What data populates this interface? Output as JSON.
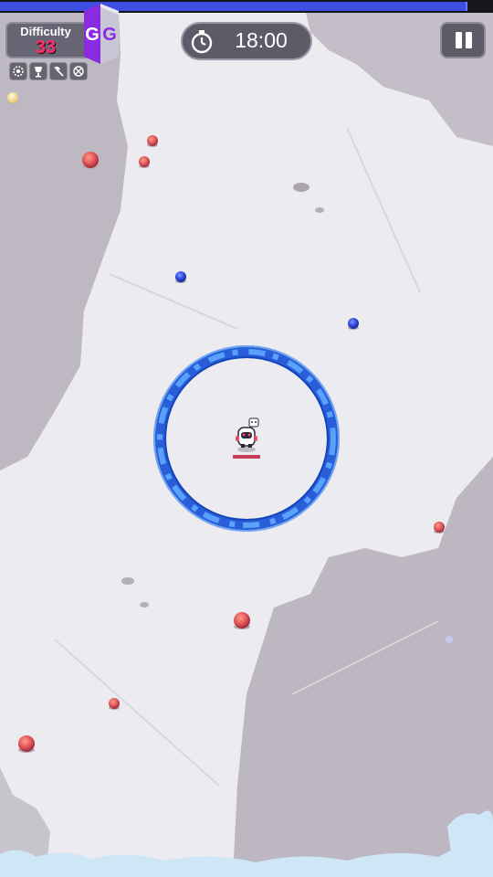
{
  "hud": {
    "difficulty_label": "Difficulty",
    "difficulty_value": "33",
    "overlay_logo_letters": "GG",
    "timer": "18:00",
    "xp_fraction": 0.945,
    "abilities": [
      "gear-icon",
      "trophy-icon",
      "axe-icon",
      "crosshair-icon"
    ]
  },
  "colors": {
    "ice": "#ecebf0",
    "rock": "#b9b4bd",
    "ring": "#2b6fe6",
    "gem_red": "#e35a5a",
    "gem_blue": "#2f4be0",
    "gem_gold": "#f3dc8a",
    "xp_fill": "#3d4fe0",
    "difficulty_value": "#ff2f6a",
    "logo_purple": "#8a2be2"
  },
  "entities": {
    "player": "robot-player",
    "aura": "blue-force-ring",
    "gems": [
      "red",
      "red",
      "red",
      "red",
      "blue",
      "blue",
      "red",
      "red",
      "red",
      "red",
      "gold"
    ]
  }
}
